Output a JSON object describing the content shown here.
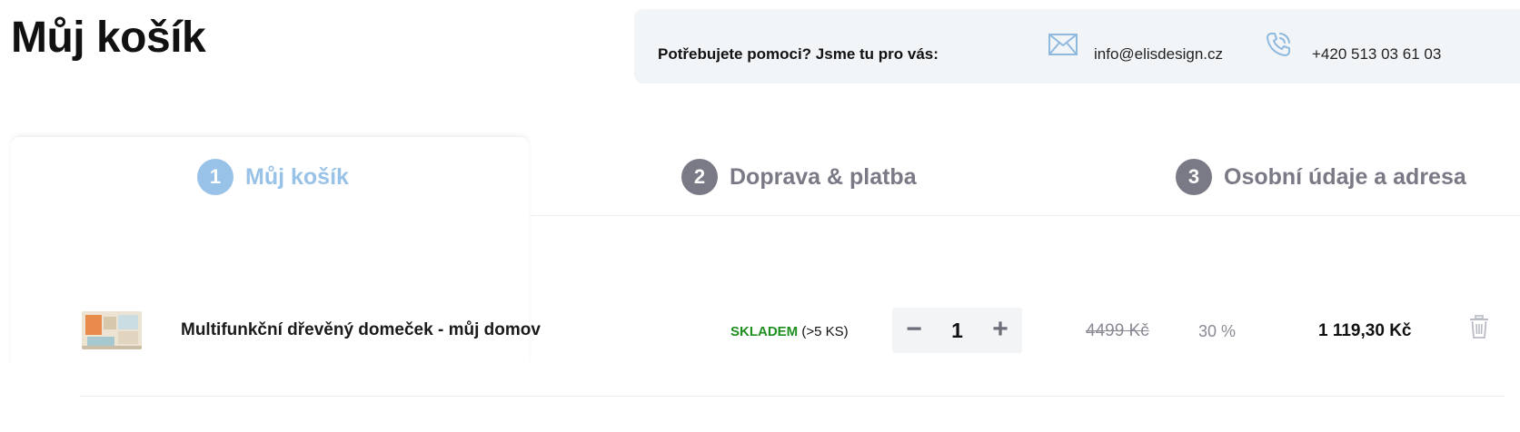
{
  "page_title": "Můj košík",
  "help": {
    "text": "Potřebujete pomoci? Jsme tu pro vás:",
    "email": "info@elisdesign.cz",
    "phone": "+420 513 03 61 03",
    "email_icon": "envelope-icon",
    "phone_icon": "phone-icon"
  },
  "steps": [
    {
      "number": "1",
      "label": "Můj košík",
      "active": true
    },
    {
      "number": "2",
      "label": "Doprava & platba",
      "active": false
    },
    {
      "number": "3",
      "label": "Osobní údaje a adresa",
      "active": false
    }
  ],
  "cart": {
    "items": [
      {
        "name": "Multifunkční dřevěný domeček - můj domov",
        "stock_status": "SKLADEM",
        "stock_qty": "(>5 KS)",
        "quantity": "1",
        "minus": "−",
        "plus": "+",
        "price_old": "4499 Kč",
        "discount": "30 %",
        "price_final": "1 119,30 Kč",
        "delete_icon": "trash-icon"
      }
    ]
  },
  "colors": {
    "step_active": "#99c2e8",
    "step_inactive": "#7a7a87",
    "stock_green": "#1f8f1f",
    "help_bg": "#f2f5f8"
  }
}
